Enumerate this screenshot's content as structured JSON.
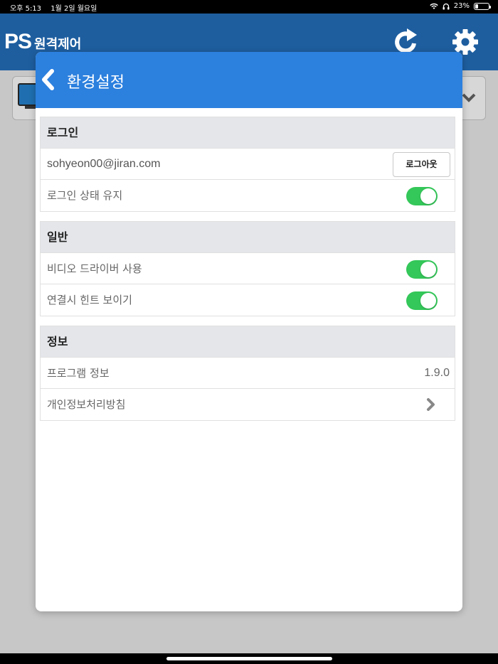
{
  "status_bar": {
    "time": "오후 5:13",
    "date": "1월 2일 월요일",
    "battery": "23%",
    "battery_level": 0.23
  },
  "app": {
    "logo_ps": "PS",
    "logo_name": "원격제어"
  },
  "modal": {
    "title": "환경설정",
    "sections": {
      "login": {
        "header": "로그인",
        "email": "sohyeon00@jiran.com",
        "logout_label": "로그아웃",
        "keep_login_label": "로그인 상태 유지",
        "keep_login_on": true
      },
      "general": {
        "header": "일반",
        "video_driver_label": "비디오 드라이버 사용",
        "video_driver_on": true,
        "hints_label": "연결시 힌트 보이기",
        "hints_on": true
      },
      "info": {
        "header": "정보",
        "program_info_label": "프로그램 정보",
        "version": "1.9.0",
        "privacy_label": "개인정보처리방침"
      }
    }
  },
  "colors": {
    "header_blue": "#2c80de",
    "app_header": "#1e5e9f",
    "toggle_on": "#34c759"
  }
}
